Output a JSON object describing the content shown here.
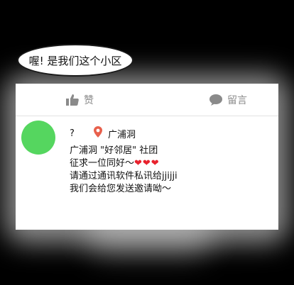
{
  "speech_bubble": {
    "text": "喔! 是我们这个小区"
  },
  "actions": {
    "like_label": "赞",
    "comment_label": "留言"
  },
  "post": {
    "username": "?",
    "location": "广浦洞",
    "lines": [
      "广浦洞 \"好邻居\" 社团",
      "征求一位同好～",
      "请通过通讯软件私讯给jjijji",
      "我们会给您发送邀请呦～"
    ],
    "hearts": "❤❤❤"
  },
  "colors": {
    "avatar": "#55d65f",
    "heart": "#e8222d",
    "muted_text": "#8a8a8a"
  }
}
